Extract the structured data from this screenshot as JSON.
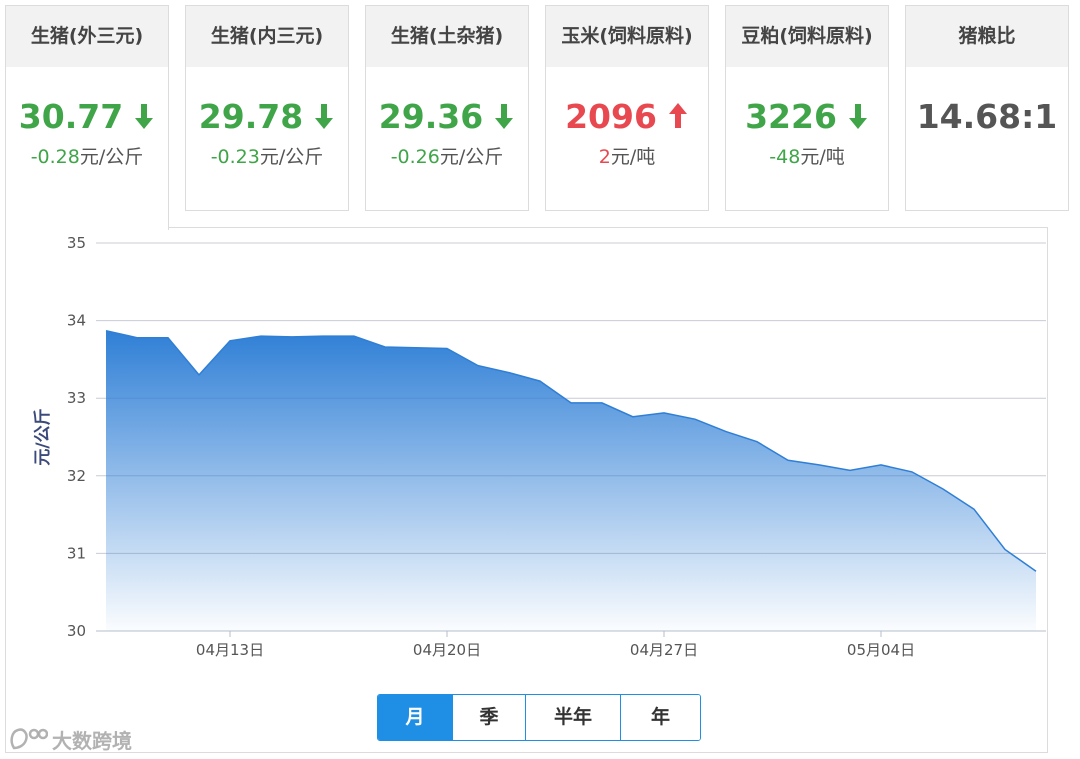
{
  "cards": [
    {
      "title": "生猪(外三元)",
      "price": "30.77",
      "change": "-0.28",
      "unit": "元/公斤",
      "trend": "down"
    },
    {
      "title": "生猪(内三元)",
      "price": "29.78",
      "change": "-0.23",
      "unit": "元/公斤",
      "trend": "down"
    },
    {
      "title": "生猪(土杂猪)",
      "price": "29.36",
      "change": "-0.26",
      "unit": "元/公斤",
      "trend": "down"
    },
    {
      "title": "玉米(饲料原料)",
      "price": "2096",
      "change": "2",
      "unit": "元/吨",
      "trend": "up"
    },
    {
      "title": "豆粕(饲料原料)",
      "price": "3226",
      "change": "-48",
      "unit": "元/吨",
      "trend": "down"
    },
    {
      "title": "猪粮比",
      "price": "14.68:1",
      "change": "",
      "unit": "",
      "trend": "none"
    }
  ],
  "colors": {
    "down": "#3fa548",
    "up": "#e8484f",
    "accent": "#1f8fe5",
    "area_top": "#2f7fd6"
  },
  "range_tabs": [
    {
      "label": "月",
      "active": true
    },
    {
      "label": "季",
      "active": false
    },
    {
      "label": "半年",
      "active": false
    },
    {
      "label": "年",
      "active": false
    }
  ],
  "watermark": "大数跨境",
  "chart_data": {
    "type": "area",
    "ylabel": "元/公斤",
    "xlabel": "",
    "ylim": [
      30,
      35
    ],
    "yticks": [
      30,
      31,
      32,
      33,
      34,
      35
    ],
    "grid": true,
    "x": [
      "04月09日",
      "04月10日",
      "04月11日",
      "04月12日",
      "04月13日",
      "04月14日",
      "04月15日",
      "04月16日",
      "04月17日",
      "04月18日",
      "04月19日",
      "04月20日",
      "04月21日",
      "04月22日",
      "04月23日",
      "04月24日",
      "04月25日",
      "04月26日",
      "04月27日",
      "04月28日",
      "04月29日",
      "04月30日",
      "05月01日",
      "05月02日",
      "05月03日",
      "05月04日",
      "05月05日",
      "05月06日",
      "05月07日",
      "05月08日",
      "05月09日"
    ],
    "xticks": [
      "04月13日",
      "04月20日",
      "04月27日",
      "05月04日"
    ],
    "series": [
      {
        "values": [
          33.87,
          33.78,
          33.78,
          33.3,
          33.74,
          33.8,
          33.79,
          33.8,
          33.8,
          33.66,
          33.65,
          33.64,
          33.42,
          33.33,
          33.22,
          32.94,
          32.94,
          32.76,
          32.81,
          32.73,
          32.57,
          32.44,
          32.2,
          32.14,
          32.07,
          32.14,
          32.05,
          31.83,
          31.57,
          31.05,
          30.77
        ]
      }
    ]
  }
}
